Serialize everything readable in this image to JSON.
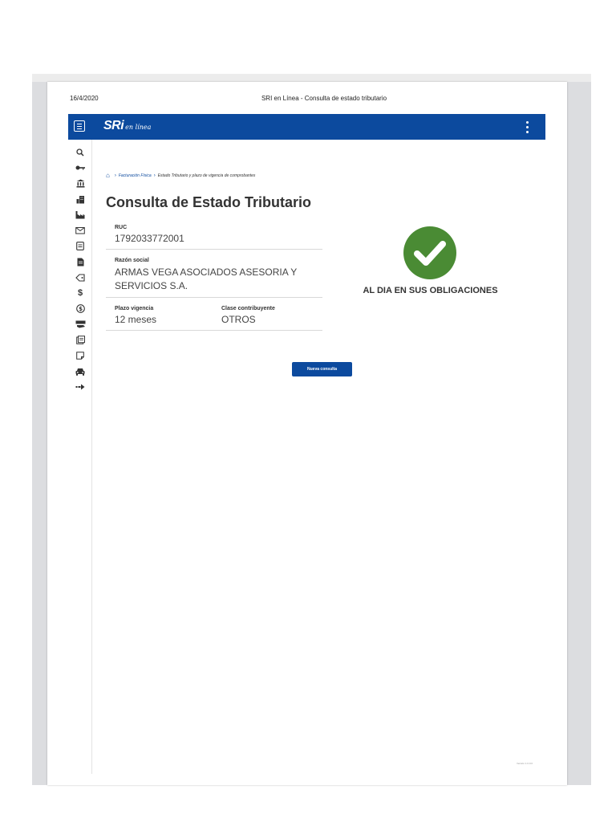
{
  "print_header": {
    "date": "16/4/2020",
    "title": "SRI en Línea - Consulta de estado tributario"
  },
  "app": {
    "logo_main": "SRi",
    "logo_sub": "en línea"
  },
  "sidebar": {
    "icons": [
      "search-icon",
      "key-icon",
      "bank-icon",
      "building-icon",
      "factory-icon",
      "envelope-icon",
      "invoice-icon",
      "document-icon",
      "tag-icon",
      "dollar-icon",
      "coin-icon",
      "hand-money-icon",
      "receipt-icon",
      "note-icon",
      "car-icon",
      "arrow-right-icon"
    ]
  },
  "breadcrumb": {
    "link": "Facturación Física",
    "current": "Estado Tributario y plazo de vigencia de comprobantes"
  },
  "page_title": "Consulta de Estado Tributario",
  "fields": {
    "ruc_label": "RUC",
    "ruc_value": "1792033772001",
    "razon_label": "Razón social",
    "razon_line1": "ARMAS VEGA ASOCIADOS ASESORIA Y",
    "razon_line2": "SERVICIOS S.A.",
    "plazo_label": "Plazo vigencia",
    "plazo_value": "12 meses",
    "clase_label": "Clase contribuyente",
    "clase_value": "OTROS"
  },
  "status": {
    "text": "AL DIA EN SUS OBLIGACIONES",
    "color": "#4a8b34"
  },
  "actions": {
    "new_query": "Nueva consulta"
  },
  "footer": {
    "note": "Versión 1.0.0.0"
  },
  "colors": {
    "brand": "#0c4a9e",
    "success": "#4a8b34"
  }
}
